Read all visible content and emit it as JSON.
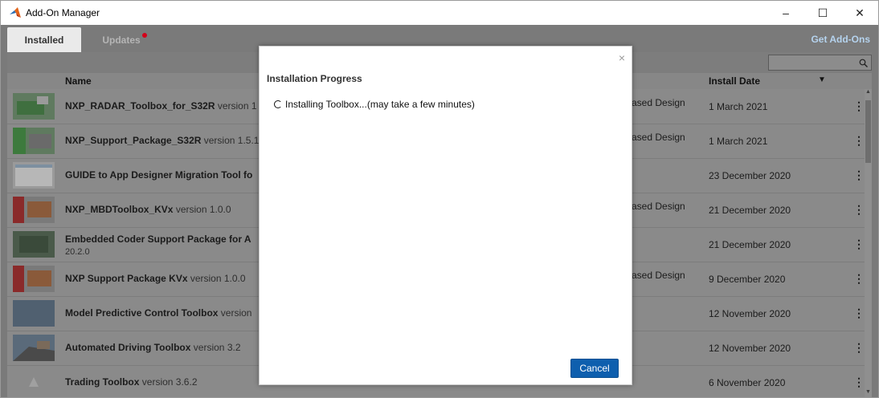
{
  "window": {
    "title": "Add-On Manager",
    "minimize": "–",
    "maximize": "☐",
    "close": "✕"
  },
  "tabs": {
    "installed": "Installed",
    "updates": "Updates",
    "get_addons": "Get Add-Ons"
  },
  "search": {
    "placeholder": ""
  },
  "table": {
    "headers": {
      "name": "Name",
      "install_date": "Install Date",
      "sort_indicator": "▼"
    },
    "rows": [
      {
        "title": "NXP_RADAR_Toolbox_for_S32R",
        "version": "version 1",
        "subtitle": "",
        "category": "ased Design",
        "date": "1 March 2021",
        "menu": "⋮"
      },
      {
        "title": "NXP_Support_Package_S32R",
        "version": "version 1.5.1",
        "subtitle": "",
        "category": "ased Design",
        "date": "1 March 2021",
        "menu": "⋮"
      },
      {
        "title": "GUIDE to App Designer Migration Tool fo",
        "version": "",
        "subtitle": "",
        "category": "",
        "date": "23 December 2020",
        "menu": "⋮"
      },
      {
        "title": "NXP_MBDToolbox_KVx",
        "version": "version 1.0.0",
        "subtitle": "",
        "category": "ased Design",
        "date": "21 December 2020",
        "menu": "⋮"
      },
      {
        "title": "Embedded Coder Support Package for A",
        "version": "",
        "subtitle": "20.2.0",
        "category": "",
        "date": "21 December 2020",
        "menu": "⋮"
      },
      {
        "title": "NXP Support Package KVx",
        "version": "version 1.0.0",
        "subtitle": "",
        "category": "ased Design",
        "date": "9 December 2020",
        "menu": "⋮"
      },
      {
        "title": "Model Predictive Control Toolbox",
        "version": "version",
        "subtitle": "",
        "category": "",
        "date": "12 November 2020",
        "menu": "⋮"
      },
      {
        "title": "Automated Driving Toolbox",
        "version": "version 3.2",
        "subtitle": "",
        "category": "",
        "date": "12 November 2020",
        "menu": "⋮"
      },
      {
        "title": "Trading Toolbox",
        "version": "version 3.6.2",
        "subtitle": "",
        "category": "",
        "date": "6 November 2020",
        "menu": "⋮"
      }
    ]
  },
  "modal": {
    "title": "Installation Progress",
    "status": "Installing Toolbox...(may take a few minutes)",
    "close": "×",
    "cancel": "Cancel"
  },
  "colors": {
    "accent": "#0e5fae",
    "overlay": "#7a7a7a",
    "badge": "#d4001a"
  }
}
